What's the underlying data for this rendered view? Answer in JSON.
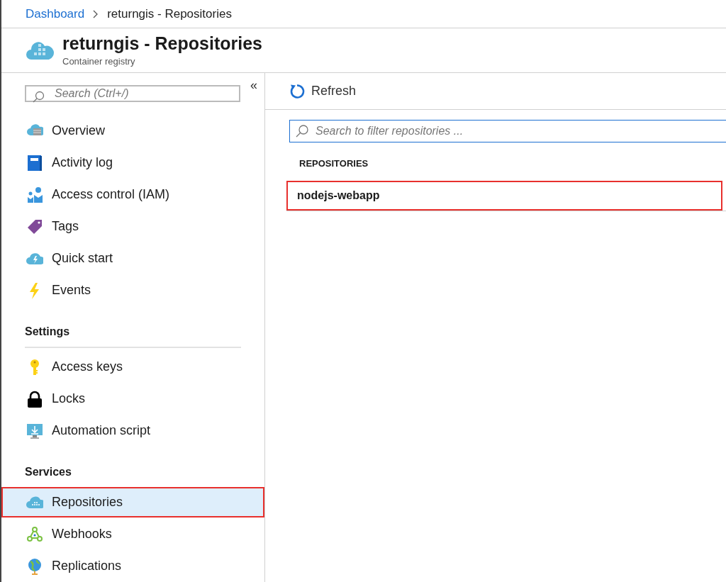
{
  "breadcrumb": [
    {
      "label": "Dashboard",
      "link": true
    },
    {
      "label": "returngis - Repositories",
      "link": false
    }
  ],
  "header": {
    "title": "returngis - Repositories",
    "subtitle": "Container registry"
  },
  "sidebar": {
    "search": {
      "placeholder": "Search (Ctrl+/)"
    },
    "collapse": "«",
    "sections": [
      {
        "items": [
          {
            "kind": "overview",
            "label": "Overview",
            "selected": false,
            "highlighted": false
          },
          {
            "kind": "activity",
            "label": "Activity log",
            "selected": false,
            "highlighted": false
          },
          {
            "kind": "iam",
            "label": "Access control (IAM)",
            "selected": false,
            "highlighted": false
          },
          {
            "kind": "tags",
            "label": "Tags",
            "selected": false,
            "highlighted": false
          },
          {
            "kind": "quickstart",
            "label": "Quick start",
            "selected": false,
            "highlighted": false
          },
          {
            "kind": "events",
            "label": "Events",
            "selected": false,
            "highlighted": false
          }
        ]
      },
      {
        "heading": "Settings",
        "items": [
          {
            "kind": "keys",
            "label": "Access keys",
            "selected": false,
            "highlighted": false
          },
          {
            "kind": "locks",
            "label": "Locks",
            "selected": false,
            "highlighted": false
          },
          {
            "kind": "automation",
            "label": "Automation script",
            "selected": false,
            "highlighted": false
          }
        ]
      },
      {
        "heading": "Services",
        "items": [
          {
            "kind": "repositories",
            "label": "Repositories",
            "selected": true,
            "highlighted": true
          },
          {
            "kind": "webhooks",
            "label": "Webhooks",
            "selected": false,
            "highlighted": false
          },
          {
            "kind": "replications",
            "label": "Replications",
            "selected": false,
            "highlighted": false
          }
        ]
      }
    ]
  },
  "toolbar": {
    "refresh": "Refresh"
  },
  "filter": {
    "placeholder": "Search to filter repositories ..."
  },
  "table": {
    "columns": [
      "REPOSITORIES"
    ],
    "rows": [
      {
        "name": "nodejs-webapp",
        "highlighted": true
      }
    ]
  }
}
